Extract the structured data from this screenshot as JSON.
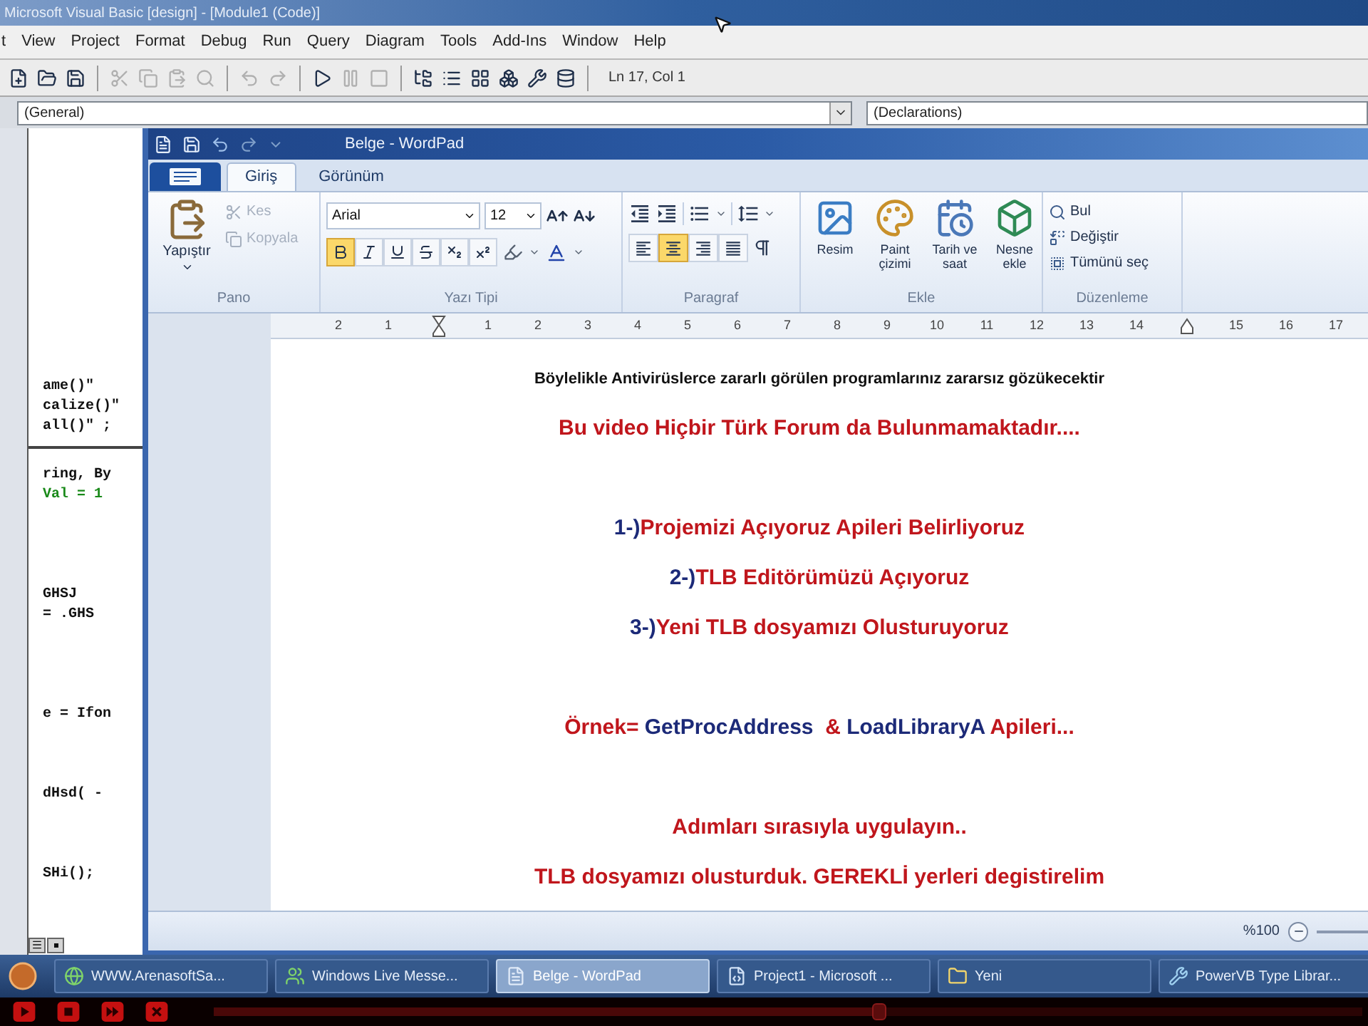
{
  "vb_window": {
    "title": "Microsoft Visual Basic [design] - [Module1 (Code)]",
    "menu": [
      "t",
      "View",
      "Project",
      "Format",
      "Debug",
      "Run",
      "Query",
      "Diagram",
      "Tools",
      "Add-Ins",
      "Window",
      "Help"
    ],
    "toolbar": {
      "button_groups": [
        [
          {
            "kind": "add_project",
            "disabled": false
          },
          {
            "kind": "open",
            "disabled": false
          },
          {
            "kind": "save",
            "disabled": false
          }
        ],
        [
          {
            "kind": "cut",
            "disabled": true
          },
          {
            "kind": "copy",
            "disabled": true
          },
          {
            "kind": "paste",
            "disabled": true
          },
          {
            "kind": "find",
            "disabled": true
          }
        ],
        [
          {
            "kind": "undo",
            "disabled": true
          },
          {
            "kind": "redo",
            "disabled": true
          }
        ],
        [
          {
            "kind": "run",
            "disabled": false
          },
          {
            "kind": "break",
            "disabled": true
          },
          {
            "kind": "end",
            "disabled": true
          }
        ],
        [
          {
            "kind": "project_explorer",
            "disabled": false
          },
          {
            "kind": "properties",
            "disabled": false
          },
          {
            "kind": "form_layout",
            "disabled": false
          },
          {
            "kind": "object_browser",
            "disabled": false
          },
          {
            "kind": "toolbox",
            "disabled": false
          },
          {
            "kind": "data_view",
            "disabled": false
          }
        ]
      ],
      "position": "Ln 17, Col 1"
    },
    "code_window": {
      "object_combo": "(General)",
      "procedure_combo": "(Declarations)",
      "top_pane": [
        {
          "kind": "code",
          "text": "ame()\""
        },
        {
          "kind": "code",
          "text": "calize()\""
        },
        {
          "kind": "code",
          "text": "all()\" ;"
        }
      ],
      "bottom_pane": [
        {
          "kind": "code",
          "text": "ring, By"
        },
        {
          "kind": "comment",
          "text": "Val = 1"
        },
        {
          "kind": "blank"
        },
        {
          "kind": "blank"
        },
        {
          "kind": "blank"
        },
        {
          "kind": "blank"
        },
        {
          "kind": "code",
          "text": "GHSJ"
        },
        {
          "kind": "code",
          "text": "= .GHS"
        },
        {
          "kind": "blank"
        },
        {
          "kind": "blank"
        },
        {
          "kind": "blank"
        },
        {
          "kind": "blank"
        },
        {
          "kind": "code",
          "text": "e = Ifon"
        },
        {
          "kind": "blank"
        },
        {
          "kind": "blank"
        },
        {
          "kind": "blank"
        },
        {
          "kind": "code",
          "text": "dHsd( -"
        },
        {
          "kind": "blank"
        },
        {
          "kind": "blank"
        },
        {
          "kind": "blank"
        },
        {
          "kind": "code",
          "text": "SHi();"
        }
      ]
    }
  },
  "wordpad": {
    "title": "Belge - WordPad",
    "tabs": [
      {
        "label": "Giriş",
        "selected": true
      },
      {
        "label": "Görünüm",
        "selected": false
      }
    ],
    "ribbon": {
      "clipboard": {
        "label": "Pano",
        "paste": "Yapıştır",
        "items": [
          {
            "kind": "cut",
            "label": "Kes",
            "disabled": true
          },
          {
            "kind": "copy",
            "label": "Kopyala",
            "disabled": true
          }
        ]
      },
      "font": {
        "label": "Yazı Tipi",
        "family": "Arial",
        "size": "12",
        "format_buttons": [
          {
            "kind": "bold",
            "selected": true
          },
          {
            "kind": "italic",
            "selected": false
          },
          {
            "kind": "underline",
            "selected": false
          },
          {
            "kind": "strikethrough",
            "selected": false
          },
          {
            "kind": "subscript",
            "selected": false
          },
          {
            "kind": "superscript",
            "selected": false
          }
        ]
      },
      "paragraph": {
        "label": "Paragraf",
        "align_buttons": [
          {
            "kind": "left",
            "selected": false
          },
          {
            "kind": "center",
            "selected": true
          },
          {
            "kind": "right",
            "selected": false
          },
          {
            "kind": "justify",
            "selected": false
          }
        ]
      },
      "insert": {
        "label": "Ekle",
        "items": [
          {
            "kind": "picture",
            "label": "Resim"
          },
          {
            "kind": "paint",
            "label": "Paint çizimi"
          },
          {
            "kind": "datetime",
            "label": "Tarih ve saat"
          },
          {
            "kind": "object",
            "label": "Nesne ekle"
          }
        ]
      },
      "editing": {
        "label": "Düzenleme",
        "items": [
          {
            "kind": "find",
            "label": "Bul"
          },
          {
            "kind": "replace",
            "label": "Değiştir"
          },
          {
            "kind": "select_all",
            "label": "Tümünü seç"
          }
        ]
      }
    },
    "ruler": {
      "left_labels": [
        "2",
        "1"
      ],
      "labels": [
        "1",
        "2",
        "3",
        "4",
        "5",
        "6",
        "7",
        "8",
        "9",
        "10",
        "11",
        "12",
        "13",
        "14",
        "15",
        "16",
        "17"
      ]
    },
    "document": {
      "paragraph_groups": [
        [
          {
            "kind": "small",
            "segments": [
              {
                "text": "Böylelikle Antivirüslerce zararlı görülen programlarınız zararsız gözükecektir",
                "color": "#111111"
              }
            ]
          },
          {
            "kind": "large",
            "segments": [
              {
                "text": "Bu video Hiçbir Türk Forum da Bulunmamaktadır....",
                "color": "#c0161c"
              }
            ]
          }
        ],
        [
          {
            "kind": "large",
            "segments": [
              {
                "text": "1-)",
                "color": "#1c2a78"
              },
              {
                "text": "Projemizi Açıyoruz Apileri Belirliyoruz",
                "color": "#c0161c"
              }
            ]
          },
          {
            "kind": "large",
            "segments": [
              {
                "text": "2-)",
                "color": "#1c2a78"
              },
              {
                "text": "TLB Editörümüzü Açıyoruz",
                "color": "#c0161c"
              }
            ]
          },
          {
            "kind": "large",
            "segments": [
              {
                "text": "3-)",
                "color": "#1c2a78"
              },
              {
                "text": "Yeni TLB dosyamızı Olusturuyoruz",
                "color": "#c0161c"
              }
            ]
          }
        ],
        [
          {
            "kind": "large",
            "segments": [
              {
                "text": "Örnek= ",
                "color": "#c0161c"
              },
              {
                "text": "GetProcAddress",
                "color": "#1c2a78"
              },
              {
                "text": "  & ",
                "color": "#c0161c"
              },
              {
                "text": "LoadLibraryA",
                "color": "#1c2a78"
              },
              {
                "text": " Apileri...",
                "color": "#c0161c"
              }
            ]
          }
        ],
        [
          {
            "kind": "large",
            "segments": [
              {
                "text": "Adımları sırasıyla uygulayın..",
                "color": "#c0161c"
              }
            ]
          },
          {
            "kind": "large",
            "segments": [
              {
                "text": "TLB dosyamızı olusturduk. GEREKLİ yerleri degistirelim",
                "color": "#c0161c"
              }
            ]
          }
        ]
      ]
    },
    "status_bar": {
      "zoom": "%100"
    }
  },
  "taskbar": {
    "items": [
      {
        "kind": "browser",
        "label": "WWW.ArenasoftSa...",
        "selected": false
      },
      {
        "kind": "messenger",
        "label": "Windows Live Messe...",
        "selected": false
      },
      {
        "kind": "wordpad",
        "label": "Belge - WordPad",
        "selected": true
      },
      {
        "kind": "vb",
        "label": "Project1 - Microsoft ...",
        "selected": false
      },
      {
        "kind": "folder",
        "label": "Yeni",
        "selected": false
      },
      {
        "kind": "tool",
        "label": "PowerVB Type Librar...",
        "selected": false
      }
    ]
  },
  "video_player": {
    "level": 0.58
  }
}
